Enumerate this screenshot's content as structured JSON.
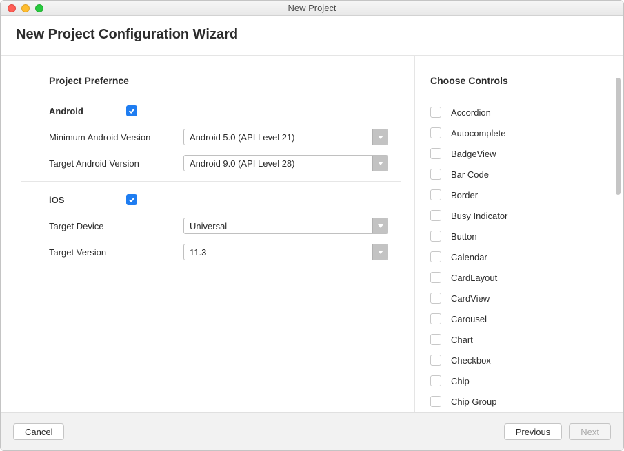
{
  "window": {
    "title": "New Project"
  },
  "header": {
    "title": "New Project Configuration Wizard"
  },
  "left": {
    "section_title": "Project Prefernce",
    "android": {
      "label": "Android",
      "checked": true,
      "min_label": "Minimum Android Version",
      "min_value": "Android 5.0 (API Level 21)",
      "target_label": "Target Android Version",
      "target_value": "Android 9.0 (API Level 28)"
    },
    "ios": {
      "label": "iOS",
      "checked": true,
      "device_label": "Target Device",
      "device_value": "Universal",
      "version_label": "Target Version",
      "version_value": "11.3"
    }
  },
  "right": {
    "section_title": "Choose Controls",
    "items": [
      "Accordion",
      "Autocomplete",
      "BadgeView",
      "Bar Code",
      "Border",
      "Busy Indicator",
      "Button",
      "Calendar",
      "CardLayout",
      "CardView",
      "Carousel",
      "Chart",
      "Checkbox",
      "Chip",
      "Chip Group"
    ]
  },
  "footer": {
    "cancel": "Cancel",
    "previous": "Previous",
    "next": "Next"
  }
}
